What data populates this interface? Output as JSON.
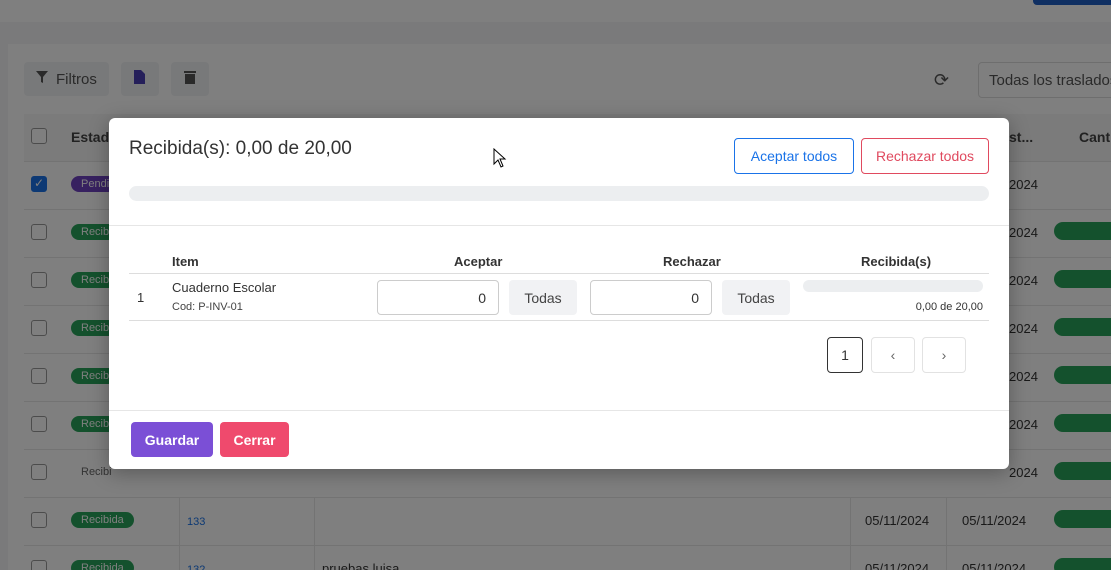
{
  "background": {
    "toolbar": {
      "filters_label": "Filtros",
      "search_placeholder": "Todas los traslados..."
    },
    "table": {
      "headers": {
        "estado": "Estado",
        "cantidad": "Canti"
      },
      "rows": [
        {
          "estado": "Pendie",
          "num": "",
          "desc": "",
          "fecha1": "",
          "fecha2": ""
        },
        {
          "estado": "Recibi",
          "num": "",
          "desc": "",
          "fecha1": "",
          "fecha2": ""
        },
        {
          "estado": "Recibi",
          "num": "",
          "desc": "",
          "fecha1": "",
          "fecha2": ""
        },
        {
          "estado": "Recibi",
          "num": "",
          "desc": "",
          "fecha1": "",
          "fecha2": ""
        },
        {
          "estado": "Recibi",
          "num": "",
          "desc": "",
          "fecha1": "",
          "fecha2": ""
        },
        {
          "estado": "Recibi",
          "num": "",
          "desc": "",
          "fecha1": "",
          "fecha2": ""
        },
        {
          "estado": "Recibi",
          "num": "",
          "desc": "",
          "fecha1": "",
          "fecha2": ""
        },
        {
          "estado": "Recibida",
          "num": "133",
          "desc": "",
          "fecha1": "05/11/2024",
          "fecha2": "05/11/2024"
        },
        {
          "estado": "Recibida",
          "num": "132",
          "desc": "pruebas luisa",
          "fecha1": "05/11/2024",
          "fecha2": "05/11/2024"
        }
      ],
      "partial_dates": [
        "2024",
        "2024",
        "2024",
        "2024",
        "2024",
        "2024",
        "2024"
      ],
      "partial_header": "st..."
    }
  },
  "modal": {
    "title": "Recibida(s): 0,00 de 20,00",
    "accept_all_label": "Aceptar todos",
    "reject_all_label": "Rechazar todos",
    "progress": 0,
    "table": {
      "headers": {
        "item": "Item",
        "accept": "Aceptar",
        "reject": "Rechazar",
        "received": "Recibida(s)"
      },
      "rows": [
        {
          "index": "1",
          "item": "Cuaderno Escolar",
          "code": "Cod: P-INV-01",
          "accept_value": "0",
          "accept_all_label": "Todas",
          "reject_value": "0",
          "reject_all_label": "Todas",
          "received_text": "0,00 de 20,00",
          "received_progress": 0
        }
      ]
    },
    "pagination": {
      "current": "1",
      "prev_icon": "‹",
      "next_icon": "›"
    },
    "footer": {
      "save_label": "Guardar",
      "close_label": "Cerrar"
    }
  },
  "colors": {
    "primary": "#1a73e8",
    "danger": "#e04a5f",
    "save": "#7b4fd6",
    "close": "#ef4a6d",
    "status_green": "#29a35a"
  }
}
